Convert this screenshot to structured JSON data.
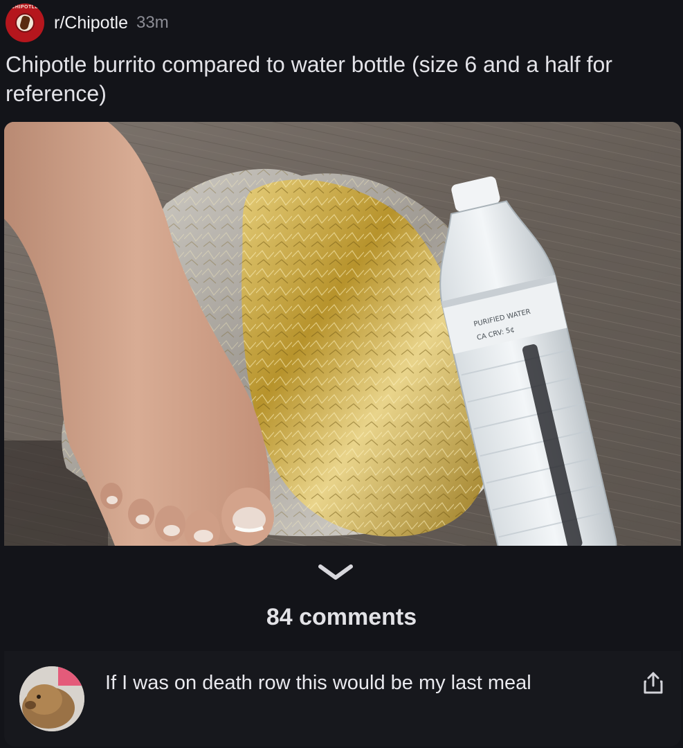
{
  "header": {
    "subreddit": "r/Chipotle",
    "age": "33m",
    "avatar_text": "CHIPOTLE"
  },
  "post": {
    "title": "Chipotle burrito compared to water bottle (size 6 and a half for reference)",
    "image_alt": "Foil-wrapped burrito next to a water bottle and a foot",
    "bottle_label": "PURIFIED WATER",
    "bottle_crv": "CA CRV: 5¢"
  },
  "comments": {
    "count_label": "84 comments",
    "items": [
      {
        "text": "If I was on death row this would be my last meal"
      }
    ]
  },
  "icons": {
    "expand": "chevron-down-icon",
    "share": "share-icon"
  },
  "colors": {
    "background": "#131419",
    "brand": "#b5161d",
    "foil": "#c9a93b"
  }
}
